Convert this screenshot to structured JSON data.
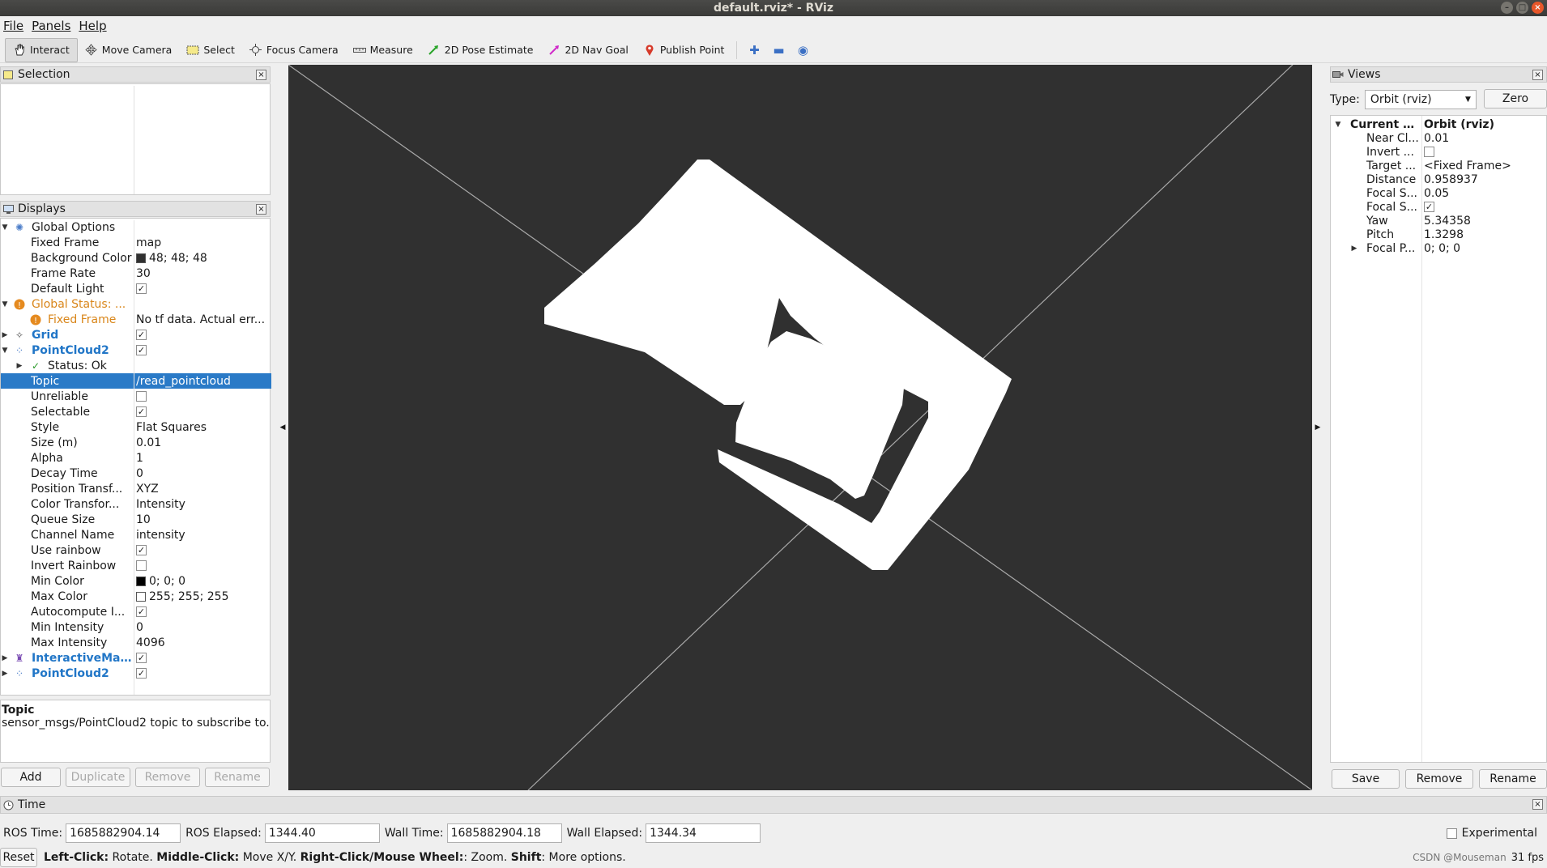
{
  "window": {
    "title": "default.rviz* - RViz"
  },
  "menu": [
    "File",
    "Panels",
    "Help"
  ],
  "toolbar": {
    "tools": [
      {
        "label": "Interact",
        "icon": "hand-icon",
        "active": true
      },
      {
        "label": "Move Camera",
        "icon": "move-icon"
      },
      {
        "label": "Select",
        "icon": "select-box-icon"
      },
      {
        "label": "Focus Camera",
        "icon": "focus-icon"
      },
      {
        "label": "Measure",
        "icon": "ruler-icon"
      },
      {
        "label": "2D Pose Estimate",
        "icon": "green-arrow-icon"
      },
      {
        "label": "2D Nav Goal",
        "icon": "magenta-arrow-icon"
      },
      {
        "label": "Publish Point",
        "icon": "red-pin-icon"
      }
    ]
  },
  "selection": {
    "title": "Selection"
  },
  "displays": {
    "title": "Displays",
    "rows": [
      {
        "label": "Global Options",
        "value": ""
      },
      {
        "label": "Fixed Frame",
        "value": "map"
      },
      {
        "label": "Background Color",
        "value": "48; 48; 48"
      },
      {
        "label": "Frame Rate",
        "value": "30"
      },
      {
        "label": "Default Light",
        "value": ""
      },
      {
        "label": "Global Status: ...",
        "value": ""
      },
      {
        "label": "Fixed Frame",
        "value": "No tf data.  Actual err..."
      },
      {
        "label": "Grid",
        "value": ""
      },
      {
        "label": "PointCloud2",
        "value": ""
      },
      {
        "label": "Status: Ok",
        "value": ""
      },
      {
        "label": "Topic",
        "value": "/read_pointcloud"
      },
      {
        "label": "Unreliable",
        "value": ""
      },
      {
        "label": "Selectable",
        "value": ""
      },
      {
        "label": "Style",
        "value": "Flat Squares"
      },
      {
        "label": "Size (m)",
        "value": "0.01"
      },
      {
        "label": "Alpha",
        "value": "1"
      },
      {
        "label": "Decay Time",
        "value": "0"
      },
      {
        "label": "Position Transf...",
        "value": "XYZ"
      },
      {
        "label": "Color Transfor...",
        "value": "Intensity"
      },
      {
        "label": "Queue Size",
        "value": "10"
      },
      {
        "label": "Channel Name",
        "value": "intensity"
      },
      {
        "label": "Use rainbow",
        "value": ""
      },
      {
        "label": "Invert Rainbow",
        "value": ""
      },
      {
        "label": "Min Color",
        "value": "0; 0; 0"
      },
      {
        "label": "Max Color",
        "value": "255; 255; 255"
      },
      {
        "label": "Autocompute I...",
        "value": ""
      },
      {
        "label": "Min Intensity",
        "value": "0"
      },
      {
        "label": "Max Intensity",
        "value": "4096"
      },
      {
        "label": "InteractiveMar...",
        "value": ""
      },
      {
        "label": "PointCloud2",
        "value": ""
      }
    ],
    "desc_title": "Topic",
    "desc_text": "sensor_msgs/PointCloud2 topic to subscribe to.",
    "buttons": {
      "add": "Add",
      "duplicate": "Duplicate",
      "remove": "Remove",
      "rename": "Rename"
    }
  },
  "views": {
    "title": "Views",
    "type_label": "Type:",
    "type_value": "Orbit (rviz)",
    "zero": "Zero",
    "rows": [
      {
        "label": "Current V...",
        "value": "Orbit (rviz)"
      },
      {
        "label": "Near Cl...",
        "value": "0.01"
      },
      {
        "label": "Invert ...",
        "value": ""
      },
      {
        "label": "Target ...",
        "value": "<Fixed Frame>"
      },
      {
        "label": "Distance",
        "value": "0.958937"
      },
      {
        "label": "Focal S...",
        "value": "0.05"
      },
      {
        "label": "Focal S...",
        "value": ""
      },
      {
        "label": "Yaw",
        "value": "5.34358"
      },
      {
        "label": "Pitch",
        "value": "1.3298"
      },
      {
        "label": "Focal P...",
        "value": "0; 0; 0"
      }
    ],
    "buttons": {
      "save": "Save",
      "remove": "Remove",
      "rename": "Rename"
    }
  },
  "time": {
    "title": "Time",
    "ros_time_label": "ROS Time:",
    "ros_time": "1685882904.14",
    "ros_elapsed_label": "ROS Elapsed:",
    "ros_elapsed": "1344.40",
    "wall_time_label": "Wall Time:",
    "wall_time": "1685882904.18",
    "wall_elapsed_label": "Wall Elapsed:",
    "wall_elapsed": "1344.34",
    "experimental": "Experimental"
  },
  "status": {
    "reset": "Reset",
    "b1": "Left-Click:",
    "t1": " Rotate. ",
    "b2": "Middle-Click:",
    "t2": " Move X/Y. ",
    "b3": "Right-Click/Mouse Wheel:",
    "t3": ": Zoom. ",
    "b4": "Shift",
    "t4": ": More options.",
    "watermark": "CSDN @Mouseman",
    "fps": "31 fps"
  },
  "colors": {
    "viewport_bg": "#303030",
    "selection_highlight": "#2a7ac7",
    "link_blue": "#2176c7",
    "warning_orange": "#d9861a"
  }
}
